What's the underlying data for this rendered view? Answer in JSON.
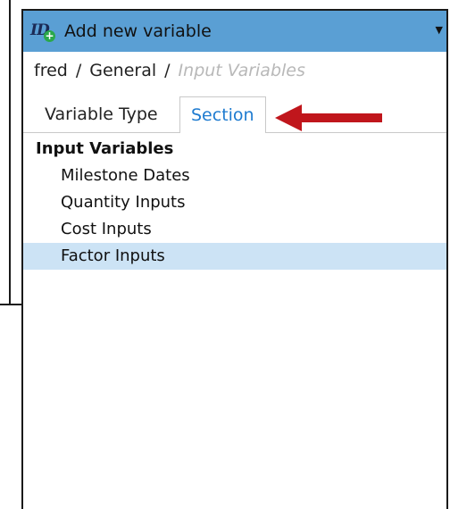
{
  "window": {
    "title": "Add new variable",
    "icon": "id-add-icon",
    "icon_text": "ID",
    "icon_badge": "+",
    "menu_glyph": "▼",
    "titlebar_color": "#5a9fd4"
  },
  "breadcrumb": {
    "items": [
      "fred",
      "General"
    ],
    "separator": "/",
    "current": "Input Variables"
  },
  "tabs": [
    {
      "label": "Variable Type",
      "active": false
    },
    {
      "label": "Section",
      "active": true,
      "color": "#1e7bd0"
    }
  ],
  "tree": {
    "root": "Input Variables",
    "items": [
      {
        "label": "Milestone Dates",
        "selected": false
      },
      {
        "label": "Quantity Inputs",
        "selected": false
      },
      {
        "label": "Cost Inputs",
        "selected": false
      },
      {
        "label": "Factor Inputs",
        "selected": true
      }
    ],
    "selection_color": "#cce3f5"
  },
  "annotation": {
    "type": "arrow",
    "color": "#c0161c",
    "points_to": "Section"
  }
}
